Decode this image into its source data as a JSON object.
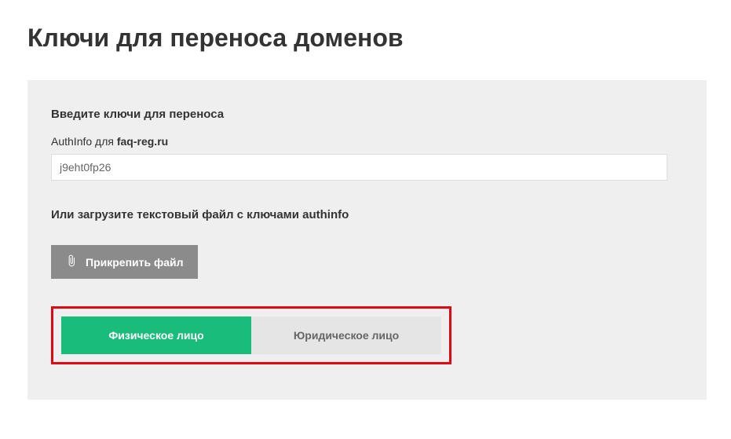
{
  "page_title": "Ключи для переноса доменов",
  "section_enter_keys": {
    "title": "Введите ключи для переноса",
    "authinfo_label_prefix": "AuthInfo для ",
    "authinfo_domain": "faq-reg.ru",
    "authinfo_value": "j9eht0fp26"
  },
  "section_upload": {
    "title": "Или загрузите текстовый файл с ключами authinfo",
    "attach_label": "Прикрепить файл"
  },
  "entity_toggle": {
    "individual": "Физическое лицо",
    "legal": "Юридическое лицо"
  },
  "colors": {
    "highlight_border": "#e30613",
    "active_toggle": "#1abc7b",
    "attach_bg": "#8b8b8b",
    "panel_bg": "#efefef"
  }
}
